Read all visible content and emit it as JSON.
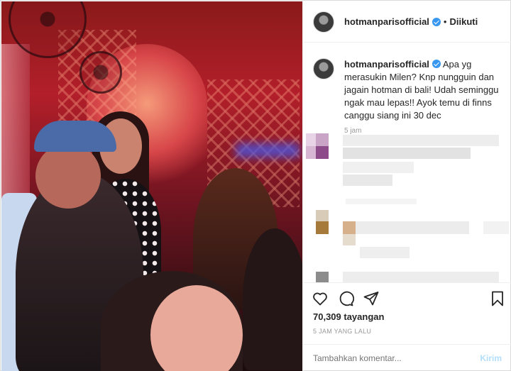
{
  "post": {
    "username": "hotmanparisofficial",
    "follow_status": "Diikuti",
    "dot": "•",
    "caption": "Apa yg merasukin Milen? Knp nungguin dan jagain hotman di bali! Udah seminggu ngak mau lepas!! Ayok temu di finns canggu siang ini 30 dec",
    "caption_time": "5 jam",
    "views": "70,309 tayangan",
    "posted_ago": "5 JAM YANG LALU"
  },
  "comment_form": {
    "placeholder": "Tambahkan komentar...",
    "post_label": "Kirim"
  },
  "colors": {
    "verified": "#3897f0",
    "post_disabled": "#b2dffc",
    "muted_text": "#999999"
  },
  "icons": [
    "heart-icon",
    "comment-icon",
    "share-icon",
    "bookmark-icon",
    "verified-badge-icon"
  ]
}
